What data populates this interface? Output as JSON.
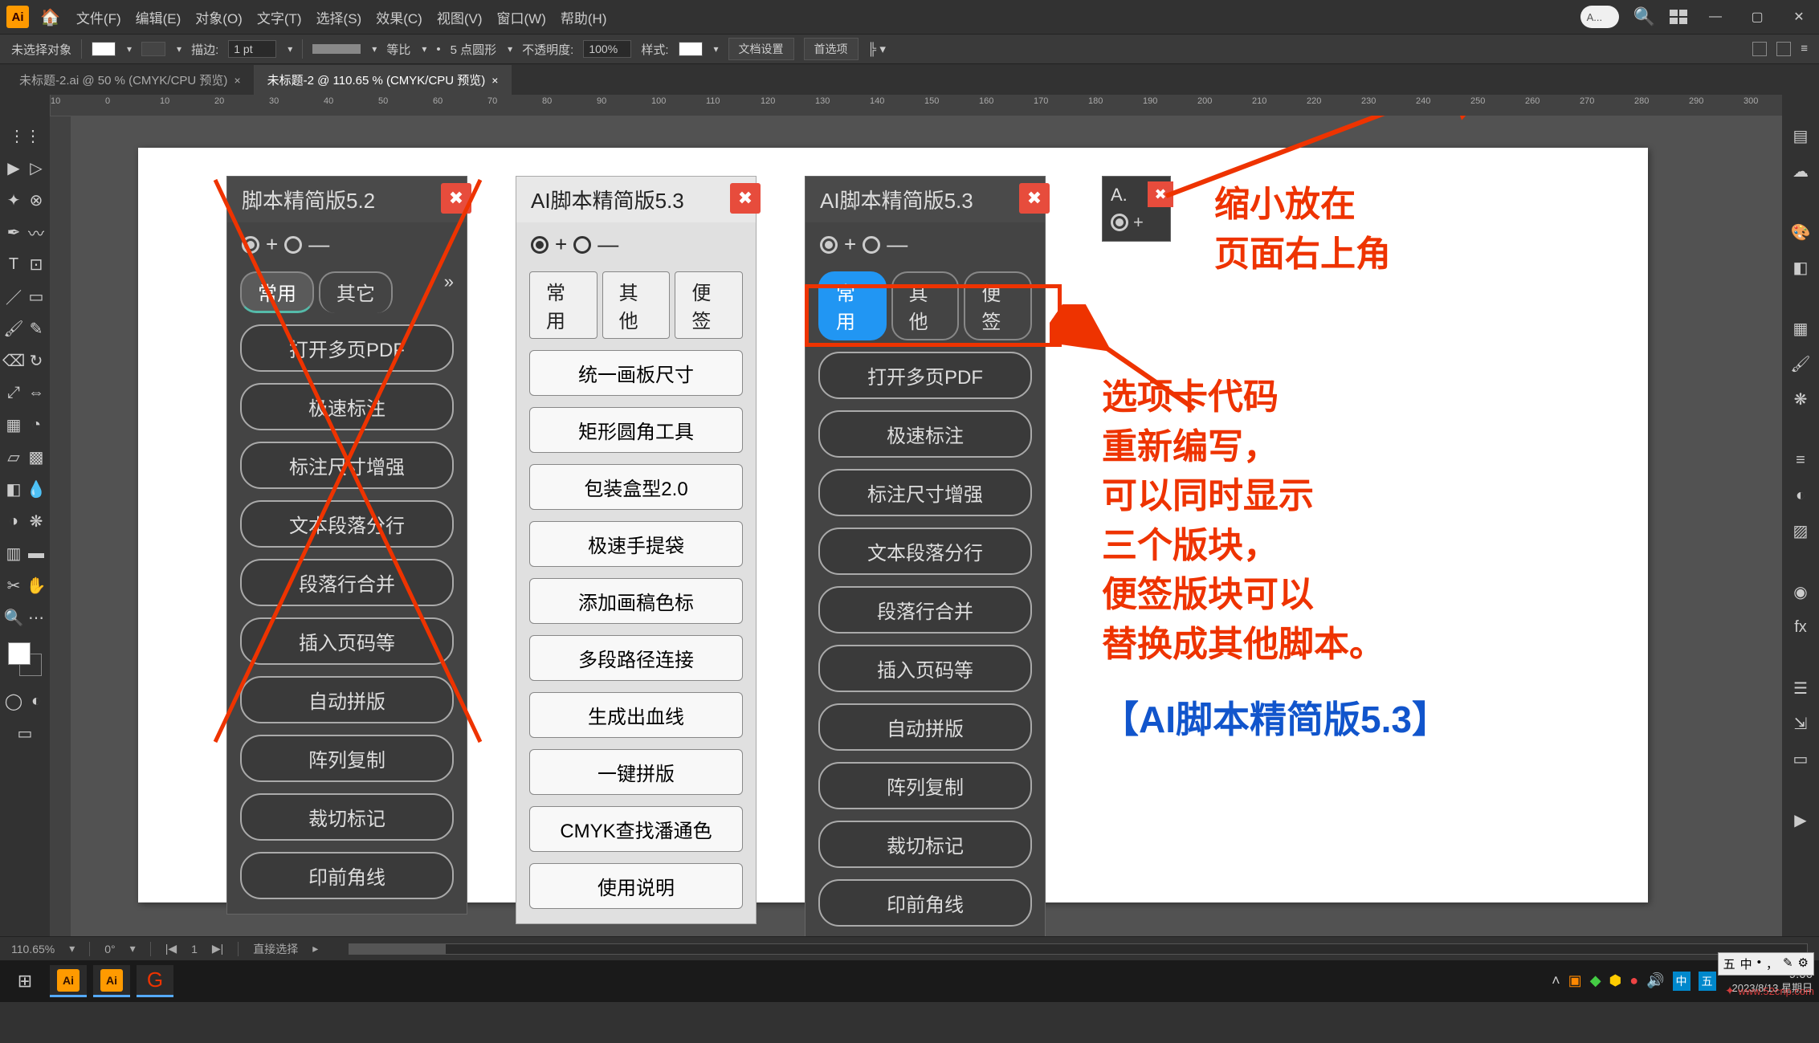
{
  "menus": {
    "file": "文件(F)",
    "edit": "编辑(E)",
    "object": "对象(O)",
    "text": "文字(T)",
    "select": "选择(S)",
    "effect": "效果(C)",
    "view": "视图(V)",
    "window": "窗口(W)",
    "help": "帮助(H)"
  },
  "titlebar": {
    "search_placeholder": "A..."
  },
  "controlbar": {
    "noselection": "未选择对象",
    "stroke": "描边:",
    "stroke_val": "1 pt",
    "uniform": "等比",
    "pt5": "5 点圆形",
    "opacity": "不透明度:",
    "opacity_val": "100%",
    "style": "样式:",
    "docsetup": "文档设置",
    "prefs": "首选项"
  },
  "tabs": {
    "t1": "未标题-2.ai @ 50 % (CMYK/CPU 预览)",
    "t2": "未标题-2 @ 110.65 % (CMYK/CPU 预览)"
  },
  "ruler_ticks": [
    "10",
    "0",
    "10",
    "20",
    "30",
    "40",
    "50",
    "60",
    "70",
    "80",
    "90",
    "100",
    "110",
    "120",
    "130",
    "140",
    "150",
    "160",
    "170",
    "180",
    "190",
    "200",
    "210",
    "220",
    "230",
    "240",
    "250",
    "260",
    "270",
    "280",
    "290",
    "300"
  ],
  "panel52": {
    "title": "脚本精简版5.2",
    "tabs": [
      "常用",
      "其它"
    ],
    "items": [
      "打开多页PDF",
      "极速标注",
      "标注尺寸增强",
      "文本段落分行",
      "段落行合并",
      "插入页码等",
      "自动拼版",
      "阵列复制",
      "裁切标记",
      "印前角线"
    ]
  },
  "panel53light": {
    "title": "AI脚本精简版5.3",
    "tabs": [
      "常用",
      "其他",
      "便签"
    ],
    "items": [
      "统一画板尺寸",
      "矩形圆角工具",
      "包装盒型2.0",
      "极速手提袋",
      "添加画稿色标",
      "多段路径连接",
      "生成出血线",
      "一键拼版",
      "CMYK查找潘通色",
      "使用说明"
    ]
  },
  "panel53dark": {
    "title": "AI脚本精简版5.3",
    "tabs": [
      "常用",
      "其他",
      "便签"
    ],
    "items": [
      "打开多页PDF",
      "极速标注",
      "标注尺寸增强",
      "文本段落分行",
      "段落行合并",
      "插入页码等",
      "自动拼版",
      "阵列复制",
      "裁切标记",
      "印前角线"
    ]
  },
  "panel_mini": {
    "title": "A."
  },
  "annot_top": "缩小放在\n页面右上角",
  "annot_mid": "选项卡代码\n重新编写，\n可以同时显示\n三个版块，\n便签版块可以\n替换成其他脚本。",
  "annot_bottom": "【AI脚本精简版5.3】",
  "status": {
    "zoom": "110.65%",
    "rot": "0°",
    "nav": "1",
    "tool": "直接选择"
  },
  "task": {
    "time": "9:06",
    "date": "2023/8/13 星期日"
  },
  "ime": {
    "a": "五",
    "b": "中",
    "c": "。",
    "d": "，",
    "e": "✎",
    "f": "⚙"
  }
}
